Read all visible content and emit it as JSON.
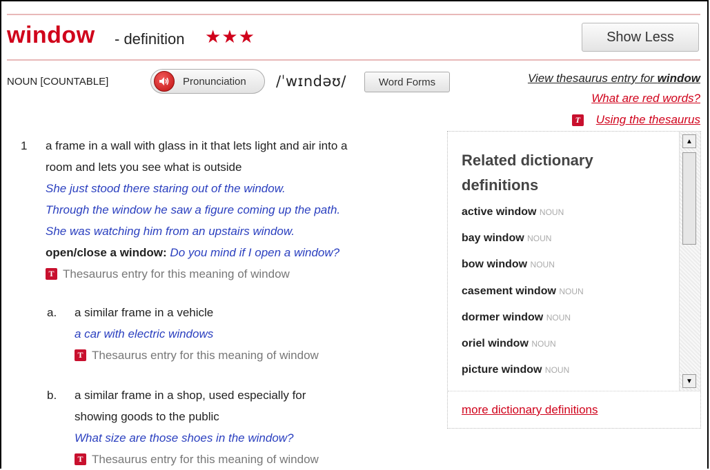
{
  "header": {
    "headword": "window",
    "definition_label": "- definition",
    "stars": "★★★",
    "show_less_label": "Show Less"
  },
  "entry_meta": {
    "part_of_speech": "NOUN [COUNTABLE]",
    "pronunciation_label": "Pronunciation",
    "ipa": "/ˈwɪndəʊ/",
    "word_forms_label": "Word Forms"
  },
  "side_links": {
    "thesaurus_prefix": "View thesaurus entry for ",
    "thesaurus_word": "window",
    "red_words": "What are red words?",
    "using_thesaurus": "Using the thesaurus"
  },
  "icons": {
    "thesaurus_badge": "T",
    "speaker": "speaker-icon"
  },
  "senses": [
    {
      "number": "1",
      "definition_line1": "a frame in a wall with glass in it that lets light and air into a",
      "definition_line2": "room and lets you see what is outside",
      "examples": [
        "She just stood there staring out of the window.",
        "Through the window he saw a figure coming up the path.",
        "She was watching him from an upstairs window."
      ],
      "phrase": "open/close a window:",
      "phrase_example": "Do you mind if I open a window?",
      "thesaurus": "Thesaurus entry for this meaning of window"
    },
    {
      "number": "a.",
      "definition_line1": "a similar frame in a vehicle",
      "example": "a car with electric windows",
      "thesaurus": "Thesaurus entry for this meaning of window"
    },
    {
      "number": "b.",
      "definition_line1": "a similar frame in a shop, used especially for",
      "definition_line2": "showing goods to the public",
      "example": "What size are those shoes in the window?",
      "thesaurus": "Thesaurus entry for this meaning of window"
    }
  ],
  "related": {
    "title_line1": "Related dictionary",
    "title_line2": "definitions",
    "items": [
      {
        "word": "active window",
        "pos": "NOUN"
      },
      {
        "word": "bay window",
        "pos": "NOUN"
      },
      {
        "word": "bow window",
        "pos": "NOUN"
      },
      {
        "word": "casement window",
        "pos": "NOUN"
      },
      {
        "word": "dormer window",
        "pos": "NOUN"
      },
      {
        "word": "oriel window",
        "pos": "NOUN"
      },
      {
        "word": "picture window",
        "pos": "NOUN"
      }
    ],
    "more_link": "more dictionary definitions"
  },
  "colors": {
    "brand_red": "#d0021b",
    "example_blue": "#2a3fbf"
  }
}
